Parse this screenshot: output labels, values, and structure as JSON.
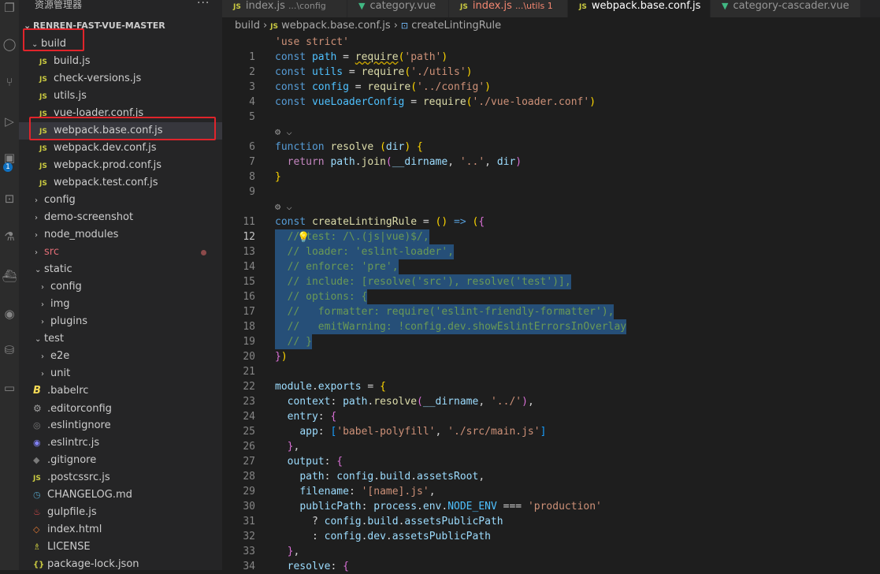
{
  "activity_bar": {
    "badge": "1"
  },
  "sidebar": {
    "title": "资源管理器",
    "more": "···",
    "root": "RENREN-FAST-VUE-MASTER",
    "items": [
      {
        "label": "build",
        "kind": "folder-open",
        "depth": 0
      },
      {
        "label": "build.js",
        "kind": "js",
        "depth": 1
      },
      {
        "label": "check-versions.js",
        "kind": "js",
        "depth": 1
      },
      {
        "label": "utils.js",
        "kind": "js",
        "depth": 1
      },
      {
        "label": "vue-loader.conf.js",
        "kind": "js",
        "depth": 1
      },
      {
        "label": "webpack.base.conf.js",
        "kind": "js",
        "depth": 1
      },
      {
        "label": "webpack.dev.conf.js",
        "kind": "js",
        "depth": 1
      },
      {
        "label": "webpack.prod.conf.js",
        "kind": "js",
        "depth": 1
      },
      {
        "label": "webpack.test.conf.js",
        "kind": "js",
        "depth": 1
      },
      {
        "label": "config",
        "kind": "folder",
        "depth": 0
      },
      {
        "label": "demo-screenshot",
        "kind": "folder",
        "depth": 0
      },
      {
        "label": "node_modules",
        "kind": "folder",
        "depth": 0
      },
      {
        "label": "src",
        "kind": "folder",
        "depth": 0
      },
      {
        "label": "static",
        "kind": "folder-open",
        "depth": 0
      },
      {
        "label": "config",
        "kind": "folder",
        "depth": 1
      },
      {
        "label": "img",
        "kind": "folder",
        "depth": 1
      },
      {
        "label": "plugins",
        "kind": "folder",
        "depth": 1
      },
      {
        "label": "test",
        "kind": "folder-open",
        "depth": 0
      },
      {
        "label": "e2e",
        "kind": "folder",
        "depth": 1
      },
      {
        "label": "unit",
        "kind": "folder",
        "depth": 1
      },
      {
        "label": ".babelrc",
        "kind": "babel",
        "depth": 0
      },
      {
        "label": ".editorconfig",
        "kind": "gear",
        "depth": 0
      },
      {
        "label": ".eslintignore",
        "kind": "eslint-ignore",
        "depth": 0
      },
      {
        "label": ".eslintrc.js",
        "kind": "eslint",
        "depth": 0
      },
      {
        "label": ".gitignore",
        "kind": "git",
        "depth": 0
      },
      {
        "label": ".postcssrc.js",
        "kind": "js",
        "depth": 0
      },
      {
        "label": "CHANGELOG.md",
        "kind": "md",
        "depth": 0
      },
      {
        "label": "gulpfile.js",
        "kind": "gulp",
        "depth": 0
      },
      {
        "label": "index.html",
        "kind": "html",
        "depth": 0
      },
      {
        "label": "LICENSE",
        "kind": "license",
        "depth": 0
      },
      {
        "label": "package-lock.json",
        "kind": "json",
        "depth": 0
      }
    ]
  },
  "tabs": [
    {
      "icon": "JS",
      "name": "index.js",
      "hint": "...\\config",
      "active": false,
      "error": false
    },
    {
      "icon": "vue",
      "name": "category.vue",
      "hint": "",
      "active": false,
      "error": false
    },
    {
      "icon": "JS",
      "name": "index.js",
      "hint": "...\\utils 1",
      "active": false,
      "error": true
    },
    {
      "icon": "JS",
      "name": "webpack.base.conf.js",
      "hint": "",
      "active": true,
      "error": false
    },
    {
      "icon": "vue",
      "name": "category-cascader.vue",
      "hint": "",
      "active": false,
      "error": false
    }
  ],
  "breadcrumb": {
    "folder": "build",
    "file": "webpack.base.conf.js",
    "symbol": "createLintingRule"
  },
  "code": {
    "lens_icon": "⚙ ⌵",
    "line_numbers": [
      "1",
      "2",
      "3",
      "4",
      "5",
      "6",
      "7",
      "8",
      "9",
      "10",
      "11",
      "12",
      "13",
      "14",
      "15",
      "16",
      "17",
      "18",
      "19",
      "20",
      "21",
      "22",
      "23",
      "24",
      "25",
      "26",
      "27",
      "28",
      "29",
      "30",
      "31",
      "32",
      "33",
      "34"
    ],
    "current_line": "12",
    "lines": {
      "l0": "'use strict'",
      "l1": "const path = require('path')",
      "l2": "const utils = require('./utils')",
      "l3": "const config = require('../config')",
      "l4": "const vueLoaderConfig = require('./vue-loader.conf')",
      "l7": "function resolve (dir) {",
      "l8": "  return path.join(__dirname, '..', dir)",
      "l9": "}",
      "l11": "const createLintingRule = () => ({",
      "l12": "  // test: /\\.(js|vue)$/,",
      "l13": "  // loader: 'eslint-loader',",
      "l14": "  // enforce: 'pre',",
      "l15": "  // include: [resolve('src'), resolve('test')],",
      "l16": "  // options: {",
      "l17": "  //   formatter: require('eslint-friendly-formatter'),",
      "l18": "  //   emitWarning: !config.dev.showEslintErrorsInOverlay",
      "l19": "  // }",
      "l20": "})",
      "l22": "module.exports = {",
      "l23": "  context: path.resolve(__dirname, '../'),",
      "l24": "  entry: {",
      "l25": "    app: ['babel-polyfill', './src/main.js']",
      "l26": "  },",
      "l27": "  output: {",
      "l28": "    path: config.build.assetsRoot,",
      "l29": "    filename: '[name].js',",
      "l30": "    publicPath: process.env.NODE_ENV === 'production'",
      "l31": "      ? config.build.assetsPublicPath",
      "l32": "      : config.dev.assetsPublicPath",
      "l33": "  },",
      "l34": "  resolve: {"
    }
  },
  "colors": {
    "highlight_box": "#e0242b",
    "selection": "#264f78",
    "accent": "#0e70c0"
  }
}
